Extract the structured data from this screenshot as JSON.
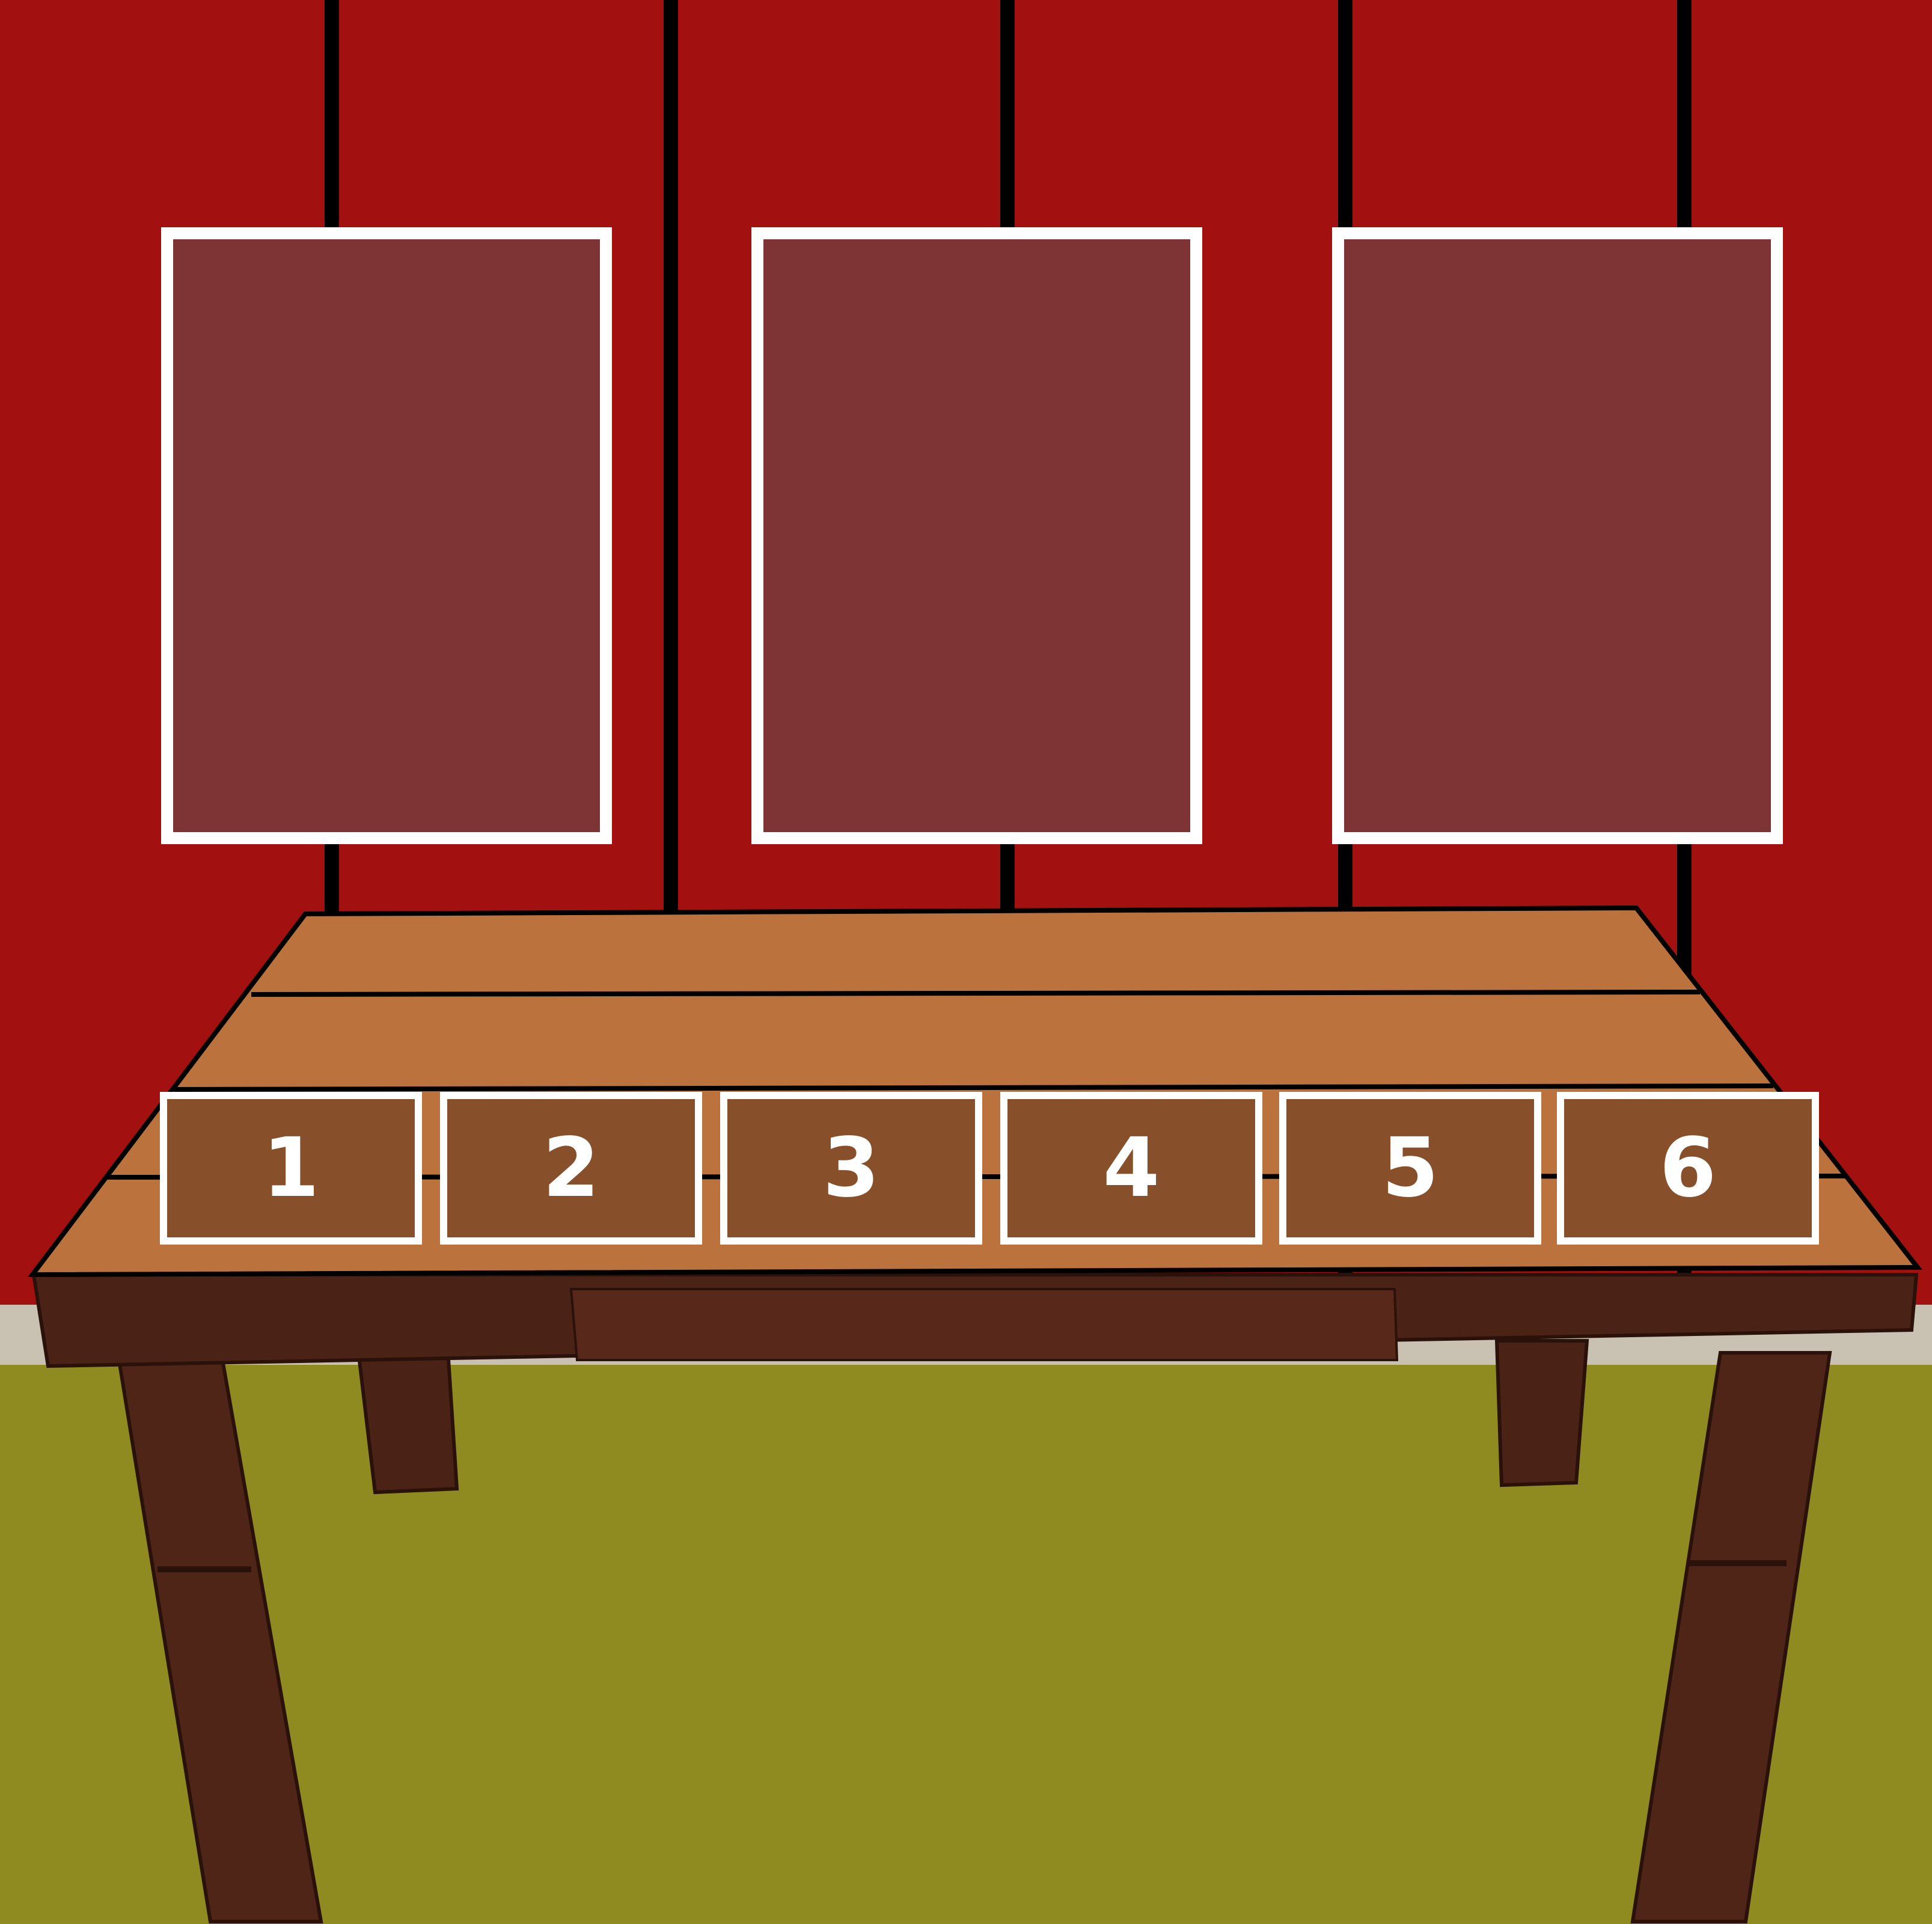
{
  "colors": {
    "wall": "#a31010",
    "seam": "#000000",
    "frame_fill": "#7e3434",
    "frame_border": "#ffffff",
    "table_top": "#bb723c",
    "table_wood": "#4a2216",
    "slot_fill": "#87502a",
    "floor": "#8f8b20",
    "baseboard": "#c9c2b2"
  },
  "frames": [
    {
      "id": "frame-1"
    },
    {
      "id": "frame-2"
    },
    {
      "id": "frame-3"
    }
  ],
  "slots": [
    {
      "label": "1"
    },
    {
      "label": "2"
    },
    {
      "label": "3"
    },
    {
      "label": "4"
    },
    {
      "label": "5"
    },
    {
      "label": "6"
    }
  ]
}
